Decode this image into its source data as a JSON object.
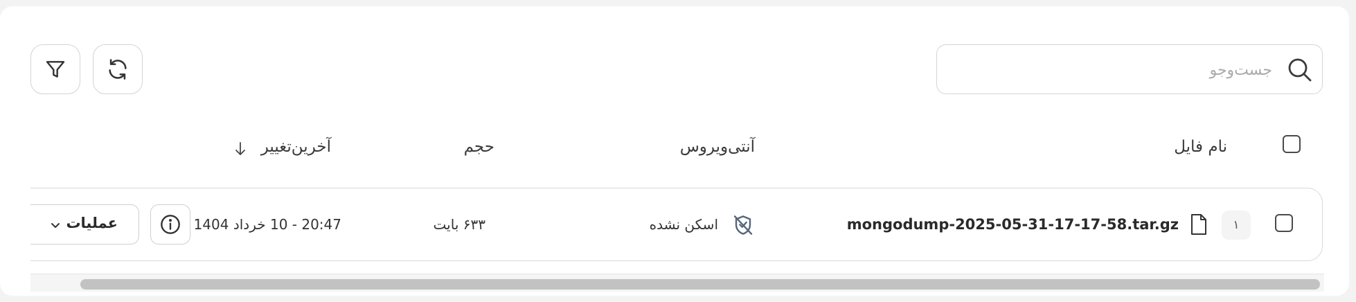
{
  "toolbar": {
    "search_placeholder": "جست‌وجو",
    "search_icon": "search-icon",
    "refresh_icon": "refresh-icon",
    "filter_icon": "filter-icon"
  },
  "table": {
    "headers": {
      "file_name": "نام فایل",
      "antivirus": "آنتی‌ویروس",
      "size": "حجم",
      "last_modified": "آخرین‌تغییر"
    },
    "sort": {
      "column": "last_modified",
      "direction": "descending"
    },
    "rows": [
      {
        "index": "۱",
        "file_name": "mongodump-2025-05-31-17-17-58.tar.gz",
        "antivirus_status": "اسکن نشده",
        "size": "۶۳۳ بایت",
        "last_modified": "20:47 - 10 خرداد 1404",
        "actions_label": "عملیات"
      }
    ]
  }
}
